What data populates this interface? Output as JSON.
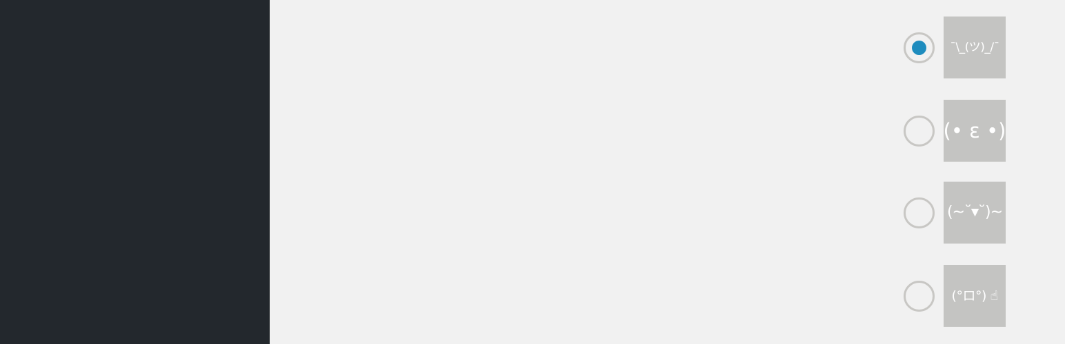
{
  "options": [
    {
      "face": "¯\\_(ツ)_/¯",
      "selected": true
    },
    {
      "face": "(• ε •)",
      "selected": false
    },
    {
      "face": "(~˘▾˘)~",
      "selected": false
    },
    {
      "face": "(°ロ°) ☝",
      "selected": false
    }
  ],
  "colors": {
    "sidebar": "#23282d",
    "background": "#f1f1f1",
    "tile": "#c4c4c2",
    "radio_border": "#c8c7c4",
    "radio_selected": "#1e8cbe"
  }
}
